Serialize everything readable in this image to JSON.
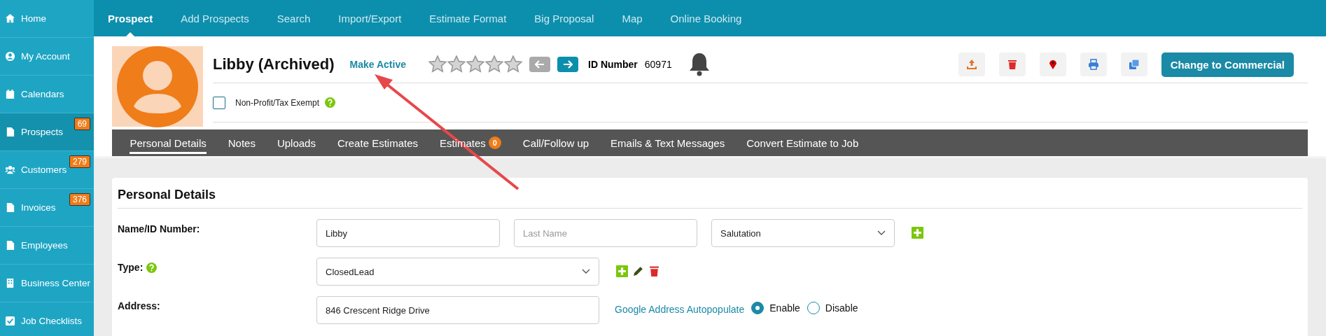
{
  "sidebar": {
    "items": [
      {
        "label": "Home",
        "selected": false
      },
      {
        "label": "My Account",
        "selected": false
      },
      {
        "label": "Calendars",
        "selected": false
      },
      {
        "label": "Prospects",
        "selected": true,
        "badge": "69"
      },
      {
        "label": "Customers",
        "selected": false,
        "badge": "279"
      },
      {
        "label": "Invoices",
        "selected": false,
        "badge": "376"
      },
      {
        "label": "Employees",
        "selected": false
      },
      {
        "label": "Business Center",
        "selected": false
      },
      {
        "label": "Job Checklists",
        "selected": false
      }
    ]
  },
  "top_nav": [
    {
      "label": "Prospect",
      "selected": true
    },
    {
      "label": "Add Prospects",
      "selected": false
    },
    {
      "label": "Search",
      "selected": false
    },
    {
      "label": "Import/Export",
      "selected": false
    },
    {
      "label": "Estimate Format",
      "selected": false
    },
    {
      "label": "Big Proposal",
      "selected": false
    },
    {
      "label": "Map",
      "selected": false
    },
    {
      "label": "Online Booking",
      "selected": false
    }
  ],
  "header": {
    "name": "Libby (Archived)",
    "make_active": "Make Active",
    "stars": 0,
    "prev_disabled": true,
    "next_disabled": false,
    "id_label": "ID Number",
    "id_value": "60971",
    "non_profit": {
      "label": "Non-Profit/Tax Exempt",
      "checked": false
    },
    "change_button": "Change to Commercial"
  },
  "sub_tabs": [
    {
      "label": "Personal Details",
      "selected": true
    },
    {
      "label": "Notes",
      "selected": false
    },
    {
      "label": "Uploads",
      "selected": false
    },
    {
      "label": "Create Estimates",
      "selected": false
    },
    {
      "label": "Estimates",
      "selected": false,
      "badge": "0"
    },
    {
      "label": "Call/Follow up",
      "selected": false
    },
    {
      "label": "Emails & Text Messages",
      "selected": false
    },
    {
      "label": "Convert Estimate to Job",
      "selected": false
    }
  ],
  "section": {
    "title": "Personal Details",
    "name_label": "Name/ID Number:",
    "first_name": "Libby",
    "last_name_placeholder": "Last Name",
    "salutation": "Salutation",
    "type_label": "Type:",
    "type_value": "ClosedLead",
    "address_label": "Address:",
    "address_value": "846 Crescent Ridge Drive",
    "autopopulate_label": "Google Address Autopopulate",
    "autopopulate_options": [
      {
        "label": "Enable",
        "selected": true
      },
      {
        "label": "Disable",
        "selected": false
      }
    ]
  }
}
